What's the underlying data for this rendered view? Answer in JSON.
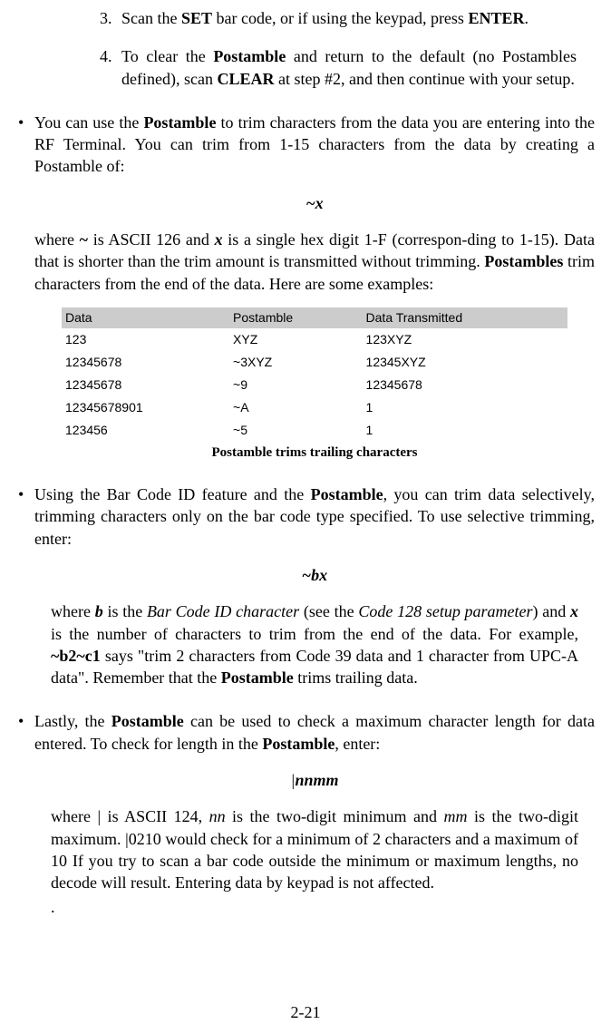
{
  "ol": {
    "item3": {
      "num": "3.",
      "t1": "Scan the ",
      "b1": "SET",
      "t2": " bar code, or if using the keypad, press ",
      "b2": "ENTER",
      "t3": "."
    },
    "item4": {
      "num": "4.",
      "t1": "To clear the ",
      "b1": "Postamble",
      "t2": " and return to the default (no Postambles defined), scan ",
      "b2": "CLEAR",
      "t3": " at step #2, and then continue with your setup."
    }
  },
  "b1": {
    "lead": {
      "t1": "You can use the ",
      "b1": "Postamble",
      "t2": " to trim characters from the data you are entering into the RF Terminal. You can trim from 1-15 characters from the data by creating a Postamble of:"
    },
    "formula": "~x",
    "post": {
      "t1": "where ",
      "b1": "~",
      "t2": " is ASCII 126 and ",
      "b2": "x",
      "t3": " is a single hex digit 1-F (correspon-ding to 1-15).  Data that is shorter than the trim amount is transmitted without trimming.  ",
      "b3": "Postambles",
      "t4": " trim characters from the end of the data. Here are some examples:"
    }
  },
  "table": {
    "headers": [
      "Data",
      "Postamble",
      "Data Transmitted"
    ],
    "rows": [
      [
        "123",
        "XYZ",
        "123XYZ"
      ],
      [
        "12345678",
        "~3XYZ",
        "12345XYZ"
      ],
      [
        "12345678",
        "~9",
        "12345678"
      ],
      [
        "12345678901",
        "~A",
        "1"
      ],
      [
        "123456",
        "~5",
        "1"
      ]
    ],
    "caption": "Postamble trims trailing characters"
  },
  "b2": {
    "lead": {
      "t1": "Using the Bar Code ID feature and the ",
      "b1": "Postamble",
      "t2": ", you can trim data selectively, trimming characters only on the bar code type specified. To use selective trimming, enter:"
    },
    "formula": "~bx",
    "post": {
      "t1": "where ",
      "b1": "b",
      "t2": " is the ",
      "i1": "Bar Code ID character",
      "t3": " (see the ",
      "i2": "Code 128 setup parameter",
      "t4": ") and ",
      "b2": "x",
      "t5": " is the number of characters to trim from the end of the data.  For example, ",
      "b3": "~b2~c1",
      "t6": " says \"trim 2 characters from Code 39 data and 1 character from UPC-A data\". Remember that the ",
      "b4": "Postamble",
      "t7": " trims trailing data."
    }
  },
  "b3": {
    "lead": {
      "t1": "Lastly, the ",
      "b1": "Postamble",
      "t2": " can be used to check a maximum character length for data entered. To check for length in the ",
      "b2": "Postamble",
      "t3": ", enter:"
    },
    "formula": "|nnmm",
    "post": {
      "t1": "where | is ASCII 124, ",
      "i1": "nn",
      "t2": " is the two-digit minimum and ",
      "i2": "mm",
      "t3": " is the two-digit maximum. |0210 would check for a minimum of 2 characters and a maximum of 10 If you try to scan a bar code outside the minimum or maximum lengths, no decode will result. Entering data by keypad is not affected."
    },
    "dot": "."
  },
  "pagenum": "2-21"
}
